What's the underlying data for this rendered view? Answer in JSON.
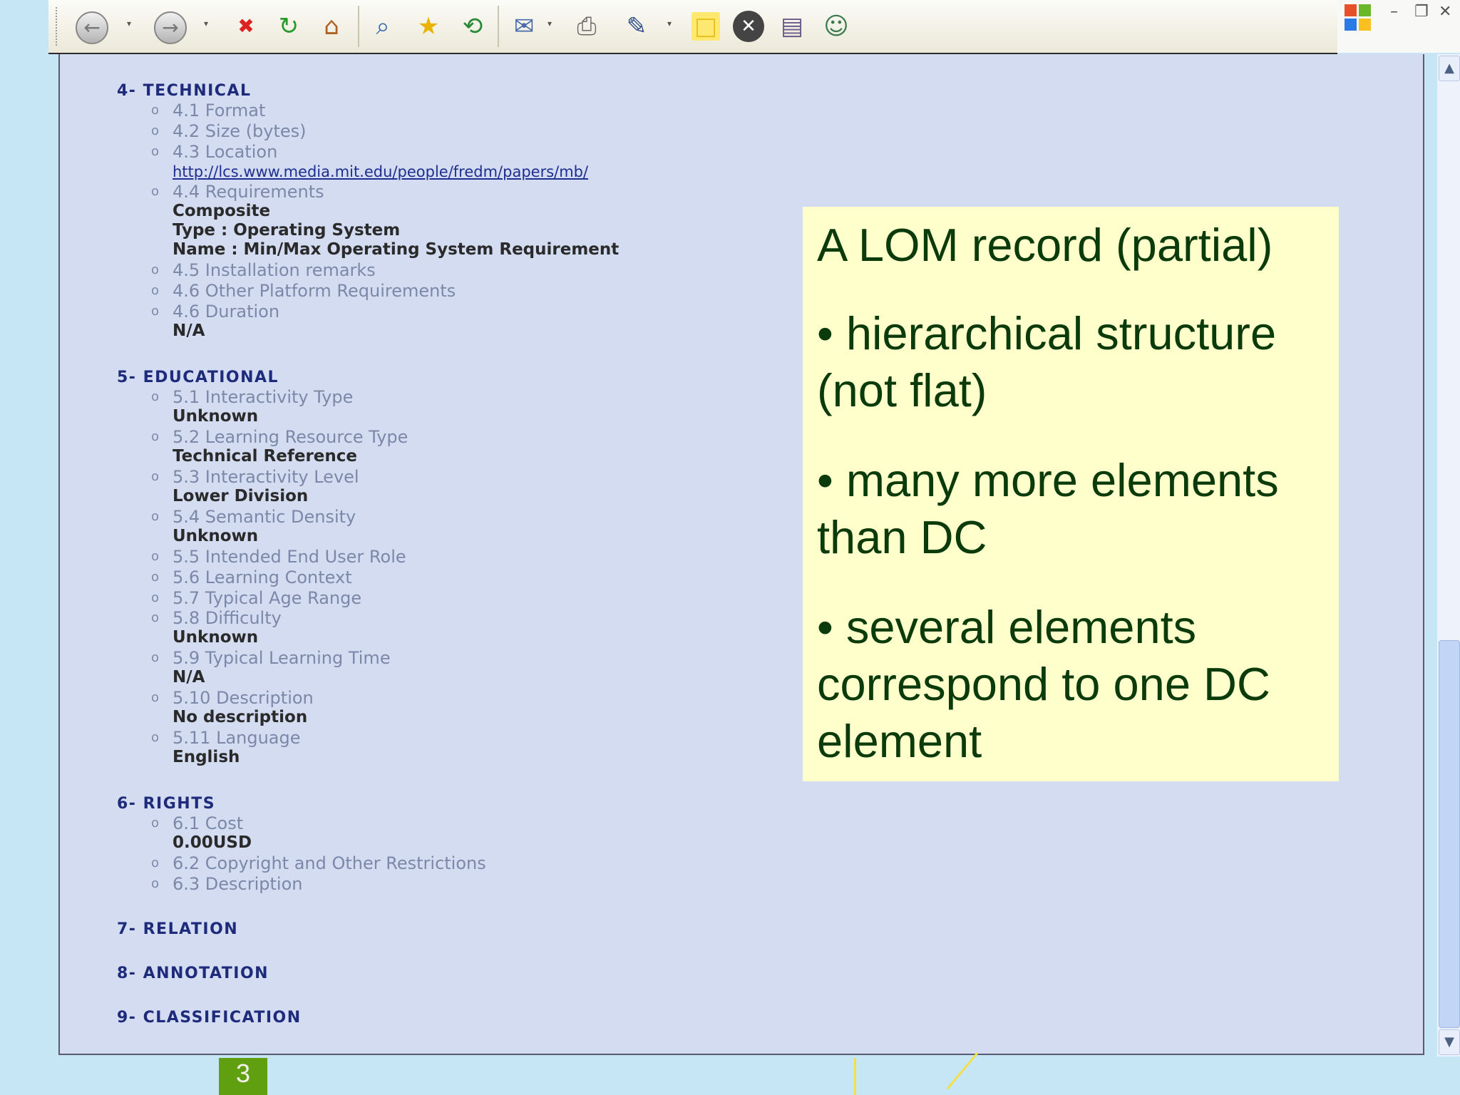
{
  "toolbar": {
    "icons": [
      "back-icon",
      "forward-icon",
      "stop-icon",
      "refresh-icon",
      "home-icon",
      "search-icon",
      "favorites-icon",
      "history-icon",
      "mail-icon",
      "print-icon",
      "edit-icon",
      "note-icon",
      "close-icon",
      "research-icon",
      "messenger-icon"
    ],
    "glyphs": {
      "back": "←",
      "forward": "→",
      "stop": "✖",
      "refresh": "↻",
      "home": "⌂",
      "search": "⌕",
      "favorites": "★",
      "history": "⟲",
      "mail": "✉",
      "print": "⎙",
      "edit": "✎",
      "note": "□",
      "close": "✕",
      "research": "▤",
      "messenger": "☺",
      "dropdown": "▾"
    }
  },
  "window_controls": {
    "minimize": "–",
    "restore": "❐",
    "close": "✕"
  },
  "lom": {
    "technical": {
      "heading": "4- TECHNICAL",
      "format": "4.1 Format",
      "size": "4.2 Size (bytes)",
      "location": "4.3 Location",
      "location_url": "http://lcs.www.media.mit.edu/people/fredm/papers/mb/",
      "requirements": "4.4 Requirements",
      "req_composite": "Composite",
      "req_type": "Type : Operating System",
      "req_name": "Name : Min/Max Operating System Requirement",
      "install": "4.5 Installation remarks",
      "other_platform": "4.6 Other Platform Requirements",
      "duration": "4.6 Duration",
      "duration_val": "N/A"
    },
    "educational": {
      "heading": "5- EDUCATIONAL",
      "items": [
        {
          "label": "5.1 Interactivity Type",
          "value": "Unknown"
        },
        {
          "label": "5.2 Learning Resource Type",
          "value": "Technical Reference"
        },
        {
          "label": "5.3 Interactivity Level",
          "value": "Lower Division"
        },
        {
          "label": "5.4 Semantic Density",
          "value": "Unknown"
        },
        {
          "label": "5.5 Intended End User Role",
          "value": ""
        },
        {
          "label": "5.6 Learning Context",
          "value": ""
        },
        {
          "label": "5.7 Typical Age Range",
          "value": ""
        },
        {
          "label": "5.8 Difficulty",
          "value": "Unknown"
        },
        {
          "label": "5.9 Typical Learning Time",
          "value": "N/A"
        },
        {
          "label": "5.10 Description",
          "value": "No description"
        },
        {
          "label": "5.11 Language",
          "value": "English"
        }
      ]
    },
    "rights": {
      "heading": "6- RIGHTS",
      "cost": "6.1 Cost",
      "cost_val": "0.00USD",
      "copyright": "6.2 Copyright and Other Restrictions",
      "description": "6.3 Description"
    },
    "relation": "7- RELATION",
    "annotation": "8- ANNOTATION",
    "classification": "9- CLASSIFICATION"
  },
  "note": {
    "title": "A LOM record (partial)",
    "b1a": "•  hierarchical structure",
    "b1b": "(not flat)",
    "b2a": "• many more elements",
    "b2b": "than DC",
    "b3a": "• several elements",
    "b3b": "correspond to one DC",
    "b3c": "element"
  },
  "slide_number": "3",
  "scrollbar": {
    "up": "▲",
    "down": "▼"
  },
  "colors": {
    "note_bg": "#ffffcc",
    "note_text": "#0b3a0b",
    "doc_bg": "#d3dcf1",
    "heading": "#1e2a7a",
    "slide_badge": "#60a010"
  }
}
